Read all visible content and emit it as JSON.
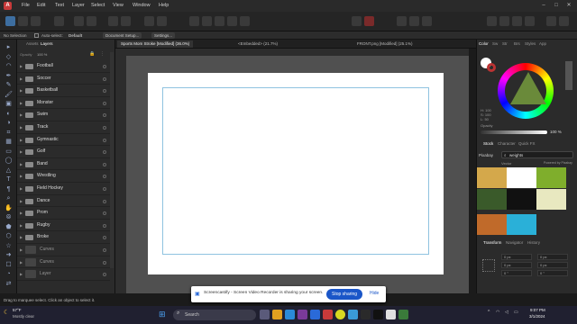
{
  "menubar": {
    "items": [
      "File",
      "Edit",
      "Text",
      "Layer",
      "Select",
      "View",
      "Window",
      "Help"
    ]
  },
  "context_bar": {
    "selection": "No Selection",
    "auto_select_label": "Auto-select:",
    "auto_select_value": "Default",
    "document_setup": "Document Setup...",
    "settings": "Settings..."
  },
  "layers_panel": {
    "tabs": [
      "Assets",
      "Layers"
    ],
    "opacity_label": "Opacity",
    "opacity_value": "100 %",
    "items": [
      {
        "name": "Football",
        "kind": "group"
      },
      {
        "name": "Soccer",
        "kind": "group"
      },
      {
        "name": "Basketball",
        "kind": "group"
      },
      {
        "name": "Monster",
        "kind": "group"
      },
      {
        "name": "Swim",
        "kind": "group"
      },
      {
        "name": "Track",
        "kind": "group"
      },
      {
        "name": "Gymnastic",
        "kind": "group"
      },
      {
        "name": "Golf",
        "kind": "group"
      },
      {
        "name": "Band",
        "kind": "group"
      },
      {
        "name": "Wrestling",
        "kind": "group"
      },
      {
        "name": "Field Hockey",
        "kind": "group"
      },
      {
        "name": "Dance",
        "kind": "group"
      },
      {
        "name": "Prom",
        "kind": "group"
      },
      {
        "name": "Rugby",
        "kind": "group"
      },
      {
        "name": "Broke",
        "kind": "group"
      },
      {
        "name": "Curves",
        "kind": "curve"
      },
      {
        "name": "Curves",
        "kind": "curve"
      },
      {
        "name": "Layer",
        "kind": "layer"
      }
    ]
  },
  "doc_tabs": [
    "Sports Mom Stroke [Modified] (36.0%)",
    "<Embedded> (21.7%)",
    "FRONT.png [Modified] (25.1%)"
  ],
  "right_panel": {
    "tabs": [
      "Color",
      "Sw",
      "Str",
      "Brs",
      "Styles",
      "App"
    ],
    "hsl": {
      "h_label": "H: 100",
      "s_label": "S: 100",
      "l_label": "L: 50"
    },
    "opacity_label": "Opacity",
    "opacity_value": "100 %",
    "stock_tabs": [
      "Stock",
      "Character",
      "Quick FX"
    ],
    "source": "Pixabay",
    "search_value": "weights",
    "vector_label": "Vector",
    "powered": "Powered by Pixabay",
    "transform_tabs": [
      "Transform",
      "Navigator",
      "History"
    ],
    "transform_fields": [
      "0 px",
      "0 px",
      "0 px",
      "0 px",
      "0 °",
      "0 °"
    ]
  },
  "status": {
    "text": "Drag to marquee select. Click an object to select it."
  },
  "notification": {
    "text": "Screencastify - Screen Video Recorder is sharing your screen.",
    "stop": "Stop sharing",
    "hide": "Hide"
  },
  "taskbar": {
    "weather_temp": "57°F",
    "weather_desc": "Mostly clear",
    "search_placeholder": "Search",
    "time": "9:07 PM",
    "date": "3/1/2024"
  }
}
